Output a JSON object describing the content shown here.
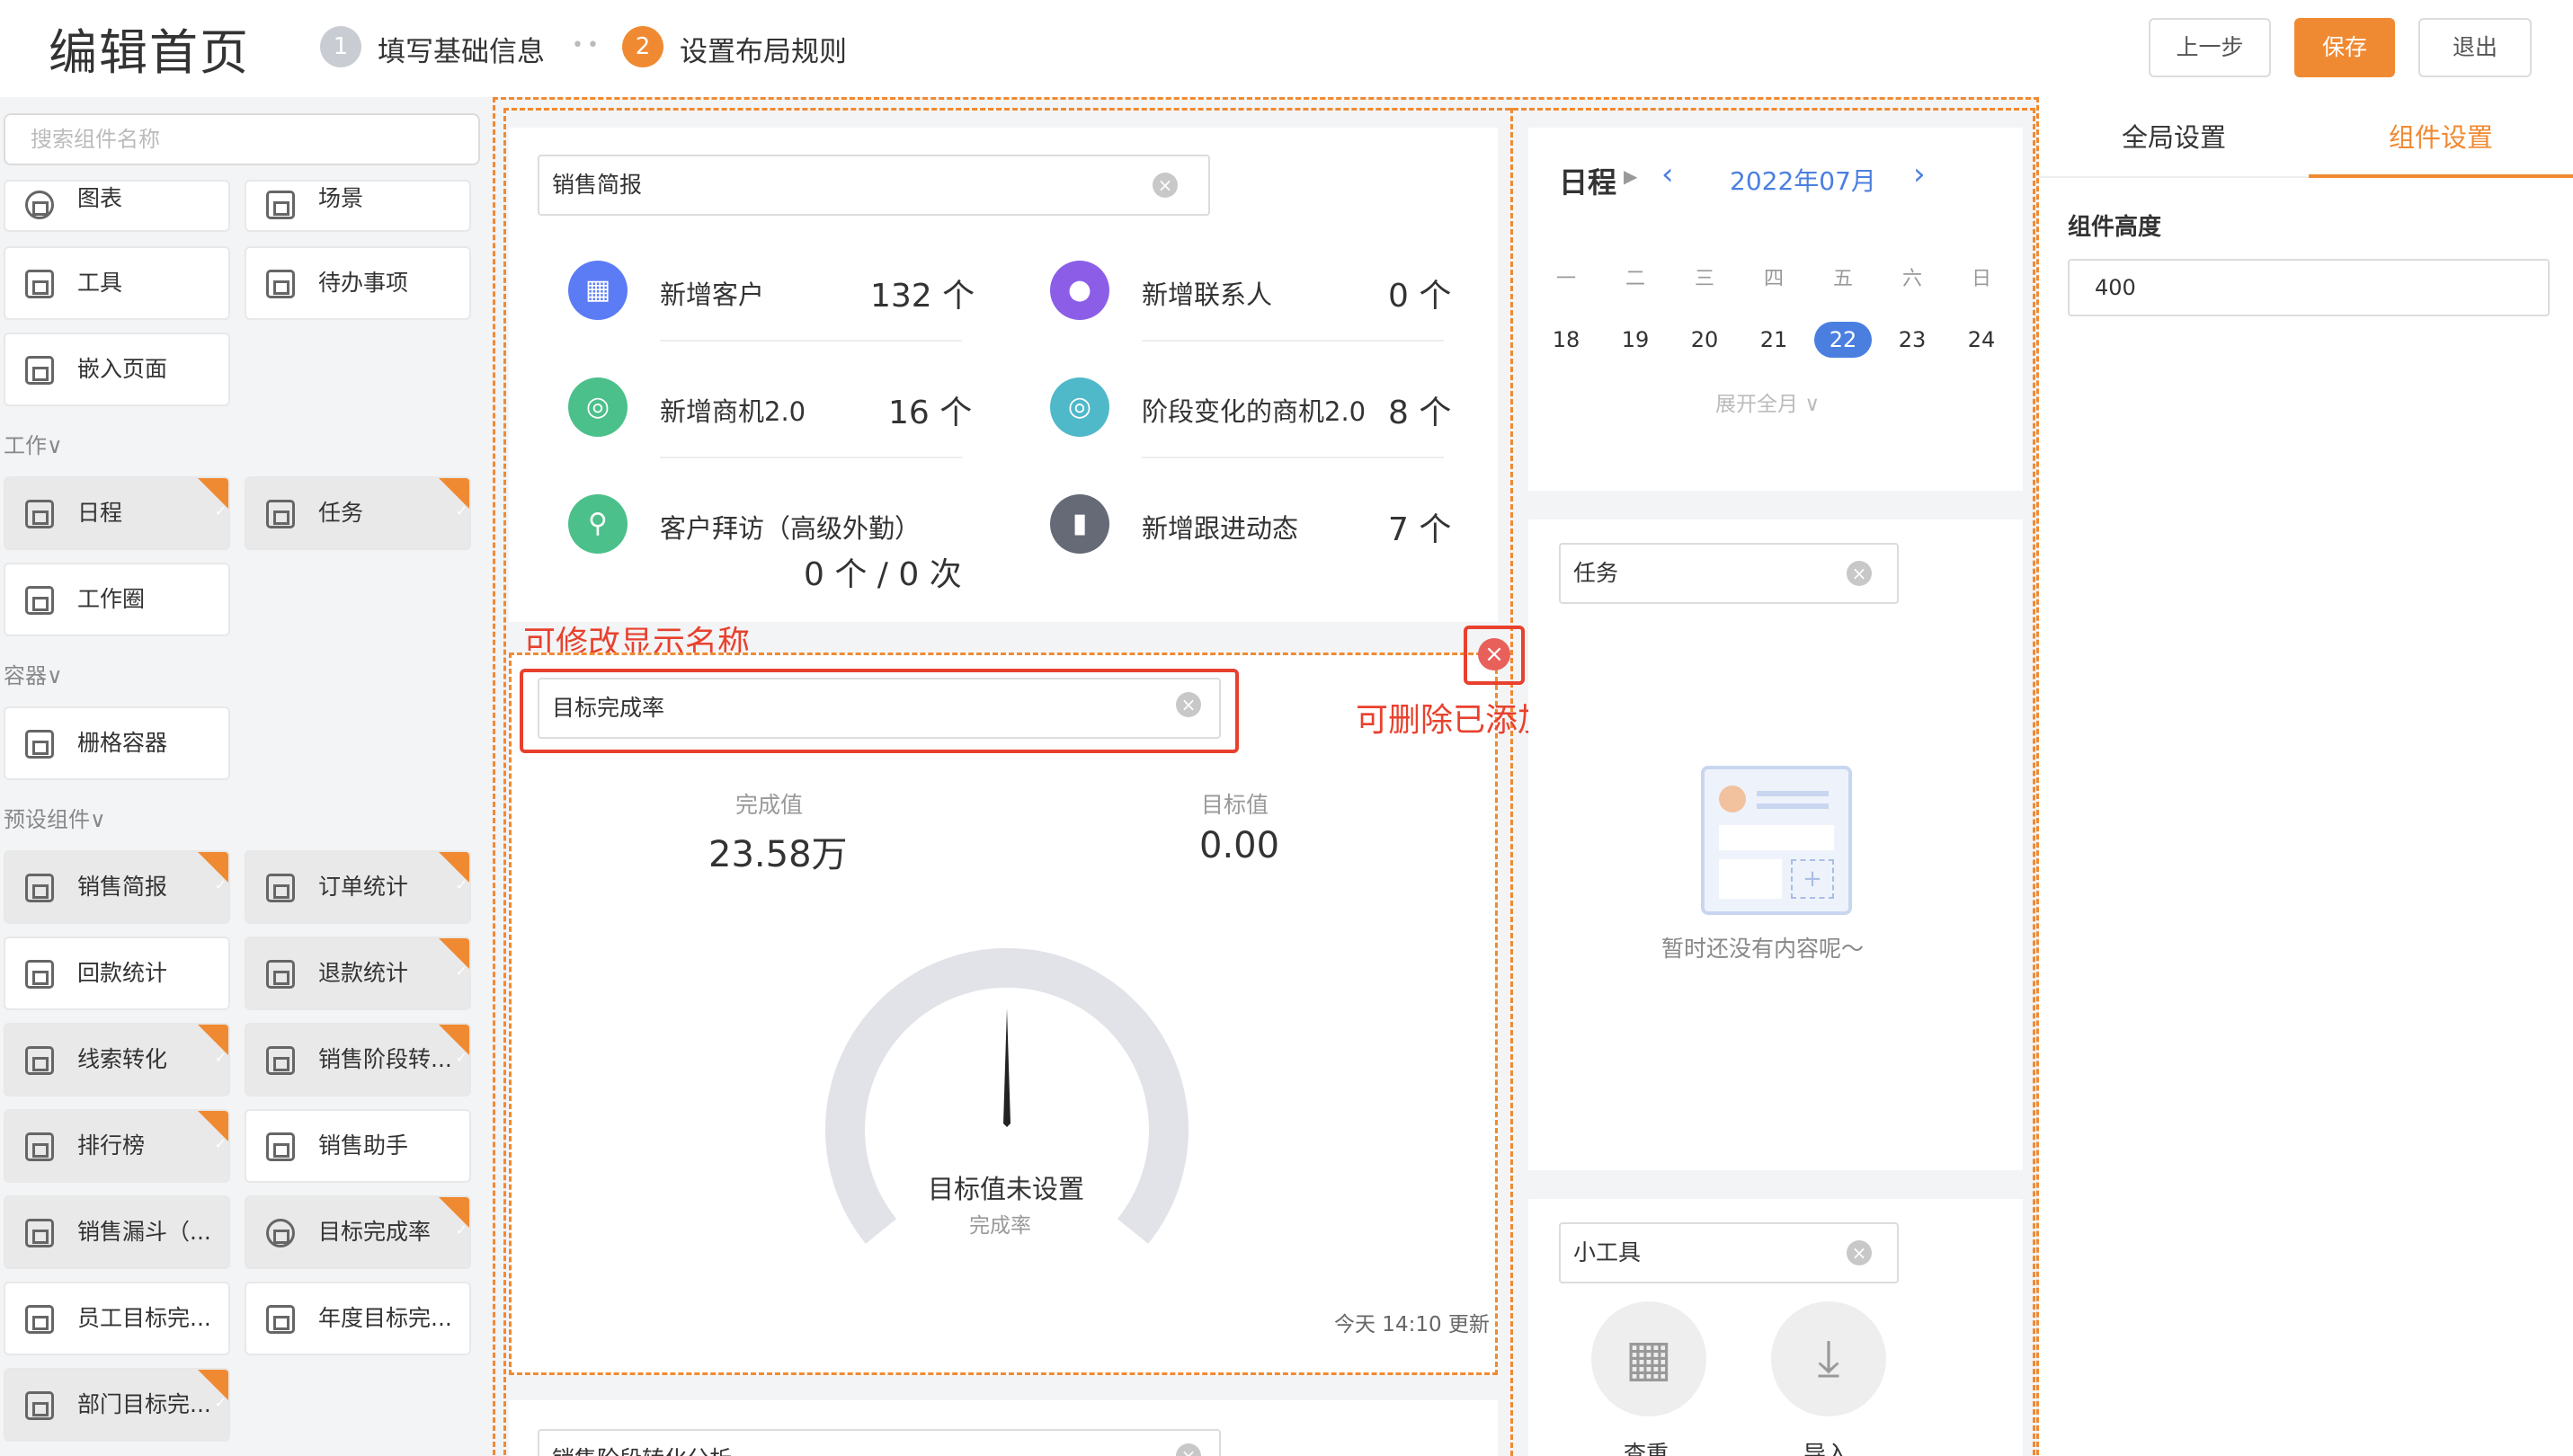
{
  "header": {
    "title": "编辑首页",
    "steps": [
      {
        "num": "1",
        "label": "填写基础信息"
      },
      {
        "num": "2",
        "label": "设置布局规则"
      }
    ],
    "buttons": {
      "prev": "上一步",
      "save": "保存",
      "exit": "退出"
    },
    "colors": {
      "accent": "#f08a32",
      "step_done": "#c9ccd3"
    }
  },
  "library": {
    "search_placeholder": "搜索组件名称",
    "top_items": [
      "图表",
      "场景",
      "工具",
      "待办事项",
      "嵌入页面"
    ],
    "categories": {
      "work": "工作",
      "container": "容器",
      "preset": "预设组件"
    },
    "work_items": [
      "日程",
      "任务",
      "工作圈"
    ],
    "container_items": [
      "栅格容器"
    ],
    "preset_items": [
      "销售简报",
      "订单统计",
      "回款统计",
      "退款统计",
      "线索转化",
      "销售阶段转...",
      "排行榜",
      "销售助手",
      "销售漏斗（...",
      "目标完成率",
      "员工目标完...",
      "年度目标完...",
      "部门目标完..."
    ]
  },
  "sales_brief": {
    "name": "销售简报",
    "stats": [
      {
        "label": "新增客户",
        "value": "132 个",
        "icon": "building-icon",
        "color": "#5b7cf5"
      },
      {
        "label": "新增联系人",
        "value": "0 个",
        "icon": "user-icon",
        "color": "#8c5ee8"
      },
      {
        "label": "新增商机2.0",
        "value": "16 个",
        "icon": "target-icon",
        "color": "#4cc08a"
      },
      {
        "label": "阶段变化的商机2.0",
        "value": "8 个",
        "icon": "target-icon",
        "color": "#4fb8c9"
      },
      {
        "label": "客户拜访（高级外勤）",
        "value": "0 个  /  0 次",
        "icon": "location-icon",
        "color": "#4cc08a"
      },
      {
        "label": "新增跟进动态",
        "value": "7 个",
        "icon": "bar-chart-icon",
        "color": "#666a76"
      }
    ]
  },
  "goal": {
    "name": "目标完成率",
    "done_label": "完成值",
    "done_value": "23.58万",
    "target_label": "目标值",
    "target_value": "0.00",
    "gauge_title": "目标值未设置",
    "gauge_sub": "完成率",
    "updated": "今天 14:10 更新"
  },
  "next_widget": {
    "name": "销售阶段转化分析"
  },
  "annotations": {
    "rename": "可修改显示名称",
    "delete": "可删除已添加的组件"
  },
  "calendar": {
    "title": "日程",
    "month": "2022年07月",
    "weekdays": [
      "一",
      "二",
      "三",
      "四",
      "五",
      "六",
      "日"
    ],
    "days": [
      "18",
      "19",
      "20",
      "21",
      "22",
      "23",
      "24"
    ],
    "today": "22",
    "expand": "展开全月"
  },
  "task": {
    "name": "任务",
    "empty": "暂时还没有内容呢～"
  },
  "tools": {
    "name": "小工具",
    "items": [
      "查重",
      "导入"
    ]
  },
  "settings": {
    "tabs": [
      "全局设置",
      "组件设置"
    ],
    "active_tab": "组件设置",
    "height_label": "组件高度",
    "height_value": "400"
  }
}
